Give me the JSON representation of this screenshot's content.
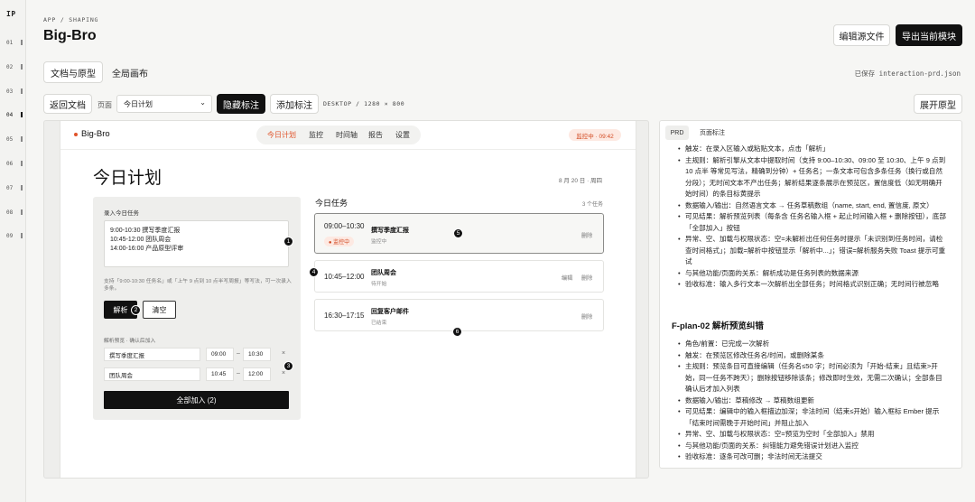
{
  "rail": {
    "logo": "IP",
    "items": [
      "01",
      "02",
      "03",
      "04",
      "05",
      "06",
      "07",
      "08",
      "09"
    ]
  },
  "header": {
    "breadcrumb": "APP / SHAPING",
    "title": "Big-Bro",
    "edit_source_label": "编辑源文件",
    "export_label": "导出当前模块"
  },
  "tabs": {
    "items": [
      "文档与原型",
      "全局画布"
    ],
    "saved": "已保存 interaction-prd.json"
  },
  "toolbar": {
    "back_label": "返回文档",
    "page_label": "页面",
    "page_value": "今日计划",
    "hide_annotations_label": "隐藏标注",
    "add_annotation_label": "添加标注",
    "viewport": "DESKTOP / 1280 × 800",
    "expand_label": "展开原型"
  },
  "prototype": {
    "brand": "Big-Bro",
    "nav": [
      "今日计划",
      "监控",
      "时间轴",
      "报告",
      "设置"
    ],
    "status": "监控中 · 09:42",
    "heading": "今日计划",
    "date": "8 月 20 日 · 周四",
    "input_panel": {
      "label": "录入今日任务",
      "lines": [
        "9:00-10:30 撰写季度汇报",
        "10:45-12:00 团队周会",
        "14:00-16:00 产品原型评审"
      ],
      "hint": "支持「9:00-10:30 任务名」或「上午 9 点到 10 点半写周报」等写法，可一次录入多条。",
      "parse_label": "解析",
      "clear_label": "清空",
      "preview_label": "解析预览 · 确认后加入",
      "rows": [
        {
          "name": "撰写季度汇报",
          "start": "09:00",
          "end": "10:30"
        },
        {
          "name": "团队周会",
          "start": "10:45",
          "end": "12:00"
        }
      ],
      "dash": "–",
      "remove_symbol": "×",
      "add_all_label": "全部加入 (2)"
    },
    "task_list": {
      "title": "今日任务",
      "count": "3 个任务",
      "tasks": [
        {
          "time": "09:00–10:30",
          "name": "撰写季度汇报",
          "sub": "监控中",
          "badge": "● 监控中",
          "edit": "",
          "delete": "删除"
        },
        {
          "time": "10:45–12:00",
          "name": "团队周会",
          "sub": "待开始",
          "edit": "编辑",
          "delete": "删除"
        },
        {
          "time": "16:30–17:15",
          "name": "回复客户邮件",
          "sub": "已结束",
          "edit": "",
          "delete": "删除"
        }
      ]
    },
    "markers": [
      "1",
      "2",
      "3",
      "4",
      "5",
      "6"
    ]
  },
  "doc_panel": {
    "tabs": [
      "PRD",
      "页面标注"
    ],
    "section1": [
      "触发：在录入区输入或粘贴文本，点击「解析」",
      "主规则：解析引擎从文本中提取时间（支持 9:00–10:30、09:00 至 10:30、上午 9 点到 10 点半 等常见写法，精确到分钟）+ 任务名；一条文本可包含多条任务（换行或自然分段）；无时间文本不产出任务；解析结果逐条展示在预览区，置信度低（如无明确开始时间）的条目标黄提示",
      "数据输入/输出：自然语言文本 → 任务草稿数组（name, start, end, 置信度, 原文）",
      "可见结果：解析预览列表（每条含 任务名输入框 + 起止时间输入框 + 删除按钮），底部「全部加入」按钮",
      "异常、空、加载与权限状态：空=未解析出任何任务时提示「未识别到任务时间，请检查时间格式」；加载=解析中按钮显示「解析中...」；错误=解析服务失败 Toast 提示可重试",
      "与其他功能/页面的关系：解析成功是任务列表的数据来源",
      "验收标准：输入多行文本一次解析出全部任务；时间格式识别正确；无时间行被忽略"
    ],
    "section2_title": "F-plan-02 解析预览纠错",
    "section2": [
      "角色/前置：已完成一次解析",
      "触发：在预览区修改任务名/时间，或删除某条",
      "主规则：预览条目可直接编辑（任务名≤50 字；时间必须为「开始-结束」且结束>开始，同一任务不跨天）；删除按钮移除该条；修改即时生效，无需二次确认；全部条目确认后才加入列表",
      "数据输入/输出：草稿修改 → 草稿数组更新",
      "可见结果：编辑中的输入框描边加深；非法时间（结束≤开始）输入框标 Ember 提示「结束时间需晚于开始时间」并阻止加入",
      "异常、空、加载与权限状态：空=预览为空时「全部加入」禁用",
      "与其他功能/页面的关系：纠错能力避免错误计划进入监控",
      "验收标准：逐条可改可删；非法时间无法提交"
    ]
  }
}
